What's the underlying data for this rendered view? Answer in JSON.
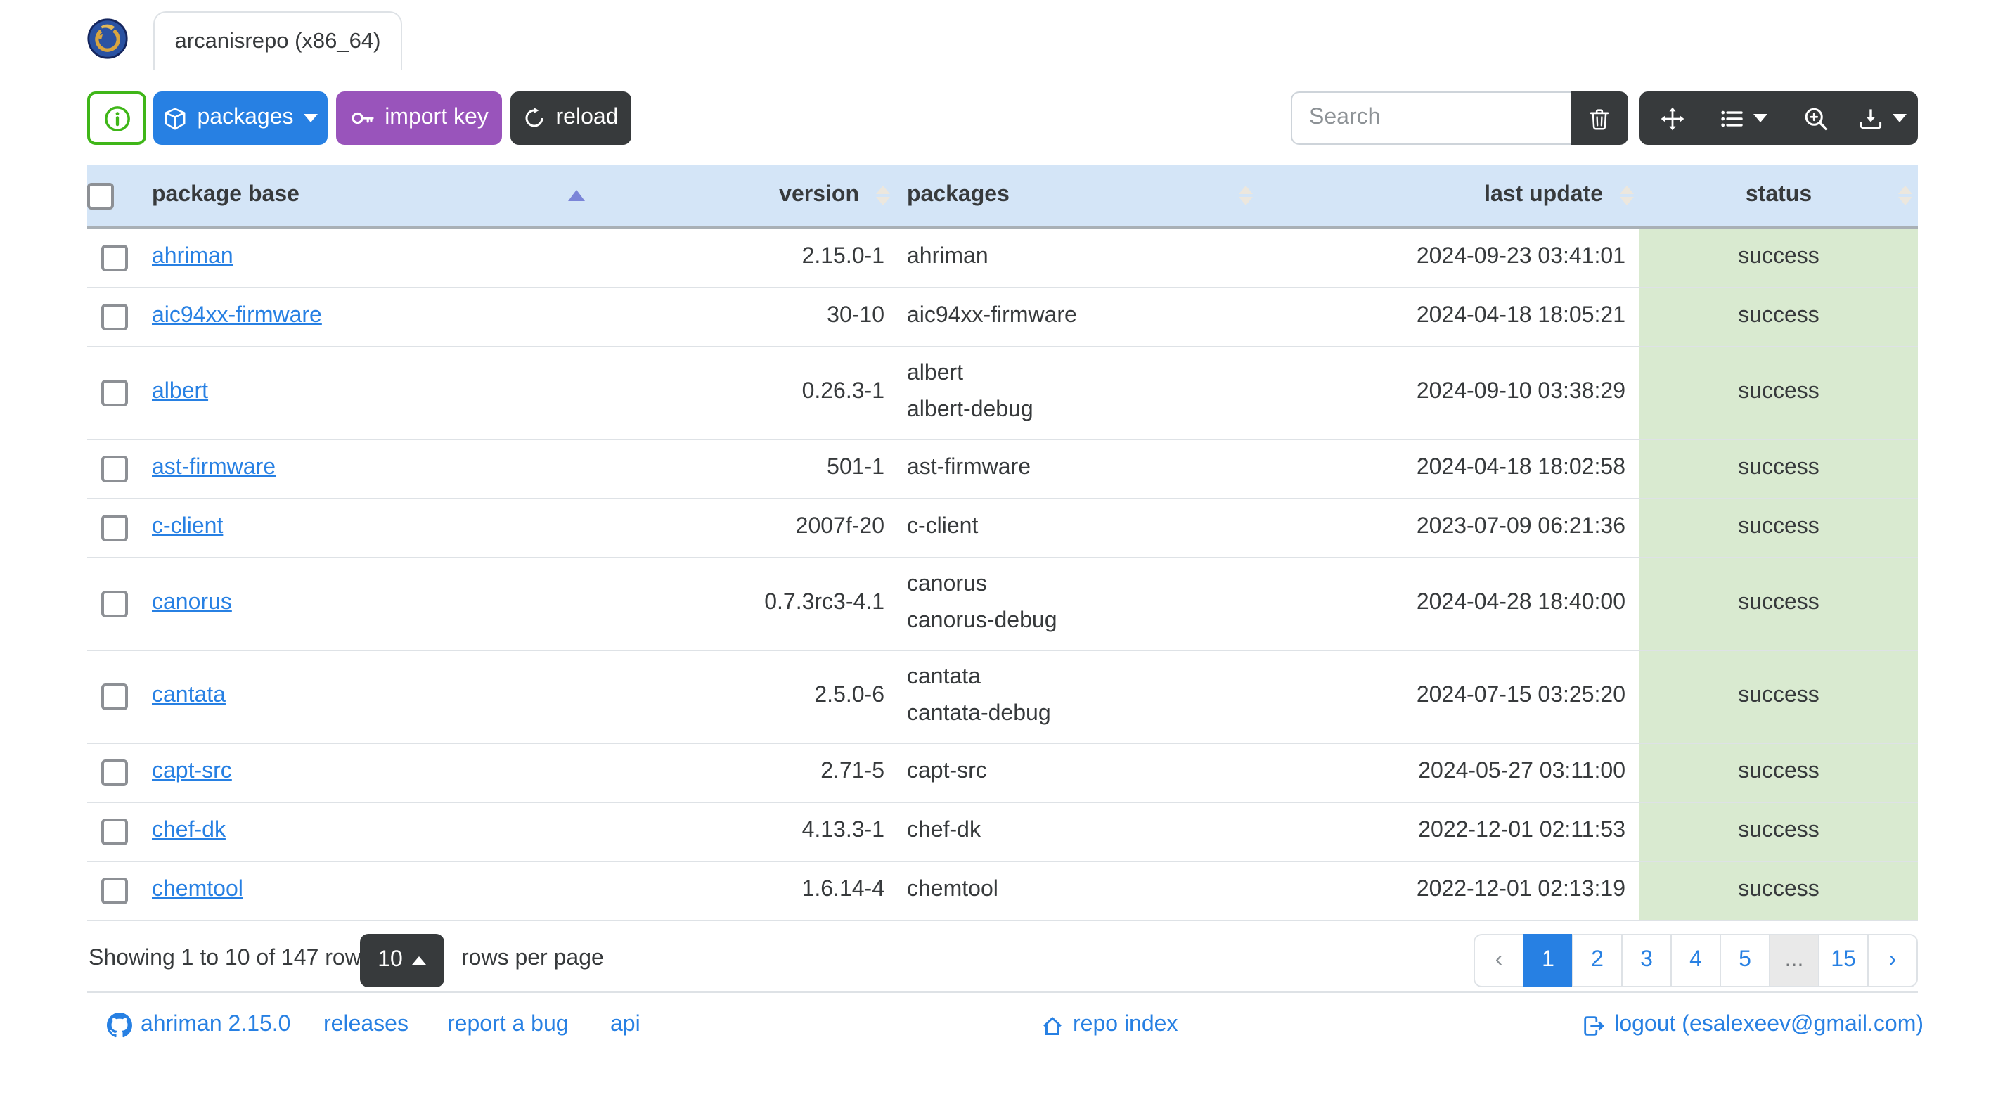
{
  "window": {
    "tab_title": "arcanisrepo (x86_64)",
    "logo": "ouroboros-dragon-logo"
  },
  "toolbar": {
    "info_icon": "info-circle-icon",
    "packages_label": "packages",
    "import_key_label": "import key",
    "reload_label": "reload",
    "search_placeholder": "Search",
    "icons": [
      "trash-icon",
      "arrows-move-icon",
      "list-columns-icon",
      "zoom-in-icon",
      "download-icon"
    ]
  },
  "table": {
    "columns": [
      "package base",
      "version",
      "packages",
      "last update",
      "status"
    ],
    "sort": {
      "column": "package base",
      "direction": "asc"
    },
    "rows": [
      {
        "base": "ahriman",
        "version": "2.15.0-1",
        "packages": [
          "ahriman"
        ],
        "last_update": "2024-09-23 03:41:01",
        "status": "success"
      },
      {
        "base": "aic94xx-firmware",
        "version": "30-10",
        "packages": [
          "aic94xx-firmware"
        ],
        "last_update": "2024-04-18 18:05:21",
        "status": "success"
      },
      {
        "base": "albert",
        "version": "0.26.3-1",
        "packages": [
          "albert",
          "albert-debug"
        ],
        "last_update": "2024-09-10 03:38:29",
        "status": "success"
      },
      {
        "base": "ast-firmware",
        "version": "501-1",
        "packages": [
          "ast-firmware"
        ],
        "last_update": "2024-04-18 18:02:58",
        "status": "success"
      },
      {
        "base": "c-client",
        "version": "2007f-20",
        "packages": [
          "c-client"
        ],
        "last_update": "2023-07-09 06:21:36",
        "status": "success"
      },
      {
        "base": "canorus",
        "version": "0.7.3rc3-4.1",
        "packages": [
          "canorus",
          "canorus-debug"
        ],
        "last_update": "2024-04-28 18:40:00",
        "status": "success"
      },
      {
        "base": "cantata",
        "version": "2.5.0-6",
        "packages": [
          "cantata",
          "cantata-debug"
        ],
        "last_update": "2024-07-15 03:25:20",
        "status": "success"
      },
      {
        "base": "capt-src",
        "version": "2.71-5",
        "packages": [
          "capt-src"
        ],
        "last_update": "2024-05-27 03:11:00",
        "status": "success"
      },
      {
        "base": "chef-dk",
        "version": "4.13.3-1",
        "packages": [
          "chef-dk"
        ],
        "last_update": "2022-12-01 02:11:53",
        "status": "success"
      },
      {
        "base": "chemtool",
        "version": "1.6.14-4",
        "packages": [
          "chemtool"
        ],
        "last_update": "2022-12-01 02:13:19",
        "status": "success"
      }
    ]
  },
  "footer_bar": {
    "summary": "Showing 1 to 10 of 147 rows",
    "page_size": "10",
    "per_page": "rows per page"
  },
  "pagination": {
    "items": [
      {
        "label": "‹",
        "kind": "prev"
      },
      {
        "label": "1",
        "kind": "active"
      },
      {
        "label": "2"
      },
      {
        "label": "3"
      },
      {
        "label": "4"
      },
      {
        "label": "5"
      },
      {
        "label": "...",
        "kind": "dots"
      },
      {
        "label": "15"
      },
      {
        "label": "›"
      }
    ]
  },
  "footer": {
    "app": "ahriman 2.15.0",
    "releases": "releases",
    "bug": "report a bug",
    "api": "api",
    "repo": "repo index",
    "logout": "logout (esalexeev@gmail.com)"
  },
  "colors": {
    "primary": "#2780e3",
    "purple": "#9954bb",
    "dark": "#373a3c",
    "success_green": "#3fb618",
    "header_bg": "#d4e5f7",
    "status_bg": "#d9ead0",
    "sort_caret": "#7b85d8",
    "border": "#dee2e6"
  }
}
